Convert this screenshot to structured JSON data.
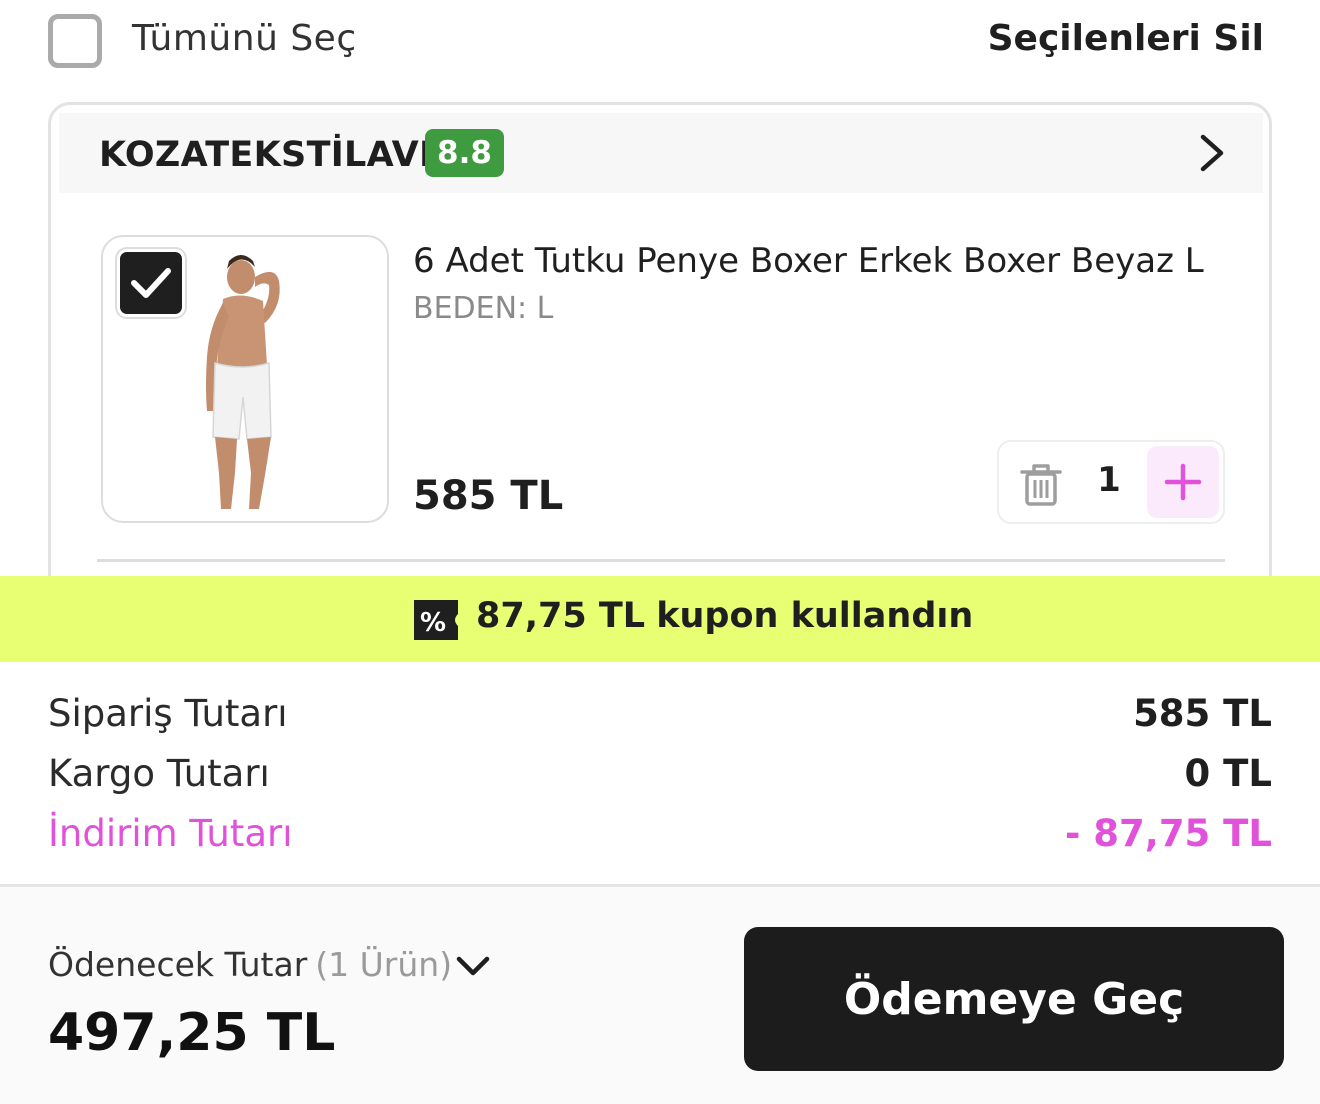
{
  "select_all": {
    "label": "Tümünü Seç",
    "checked": false
  },
  "delete_selected_label": "Seçilenleri Sil",
  "seller": {
    "name": "KOZATEKSTİLAVM",
    "score": "8.8",
    "score_color": "#3f9b3f"
  },
  "product": {
    "title": "6 Adet Tutku Penye Boxer Erkek Boxer Beyaz L",
    "variant": "BEDEN: L",
    "price": "585 TL",
    "quantity": "1",
    "checked": true
  },
  "coupon": {
    "icon": "percent-tag-icon",
    "amount": "87,75 TL",
    "text": "kupon kullandın",
    "banner_color": "#e8fe73"
  },
  "summary": {
    "order_label": "Sipariş Tutarı",
    "order_value": "585 TL",
    "shipping_label": "Kargo Tutarı",
    "shipping_value": "0 TL",
    "discount_label": "İndirim Tutarı",
    "discount_value": "- 87,75 TL",
    "discount_color": "#e052d9"
  },
  "footer": {
    "total_label": "Ödenecek Tutar",
    "item_count": "(1 Ürün)",
    "total_value": "497,25 TL",
    "checkout_label": "Ödemeye Geç"
  }
}
